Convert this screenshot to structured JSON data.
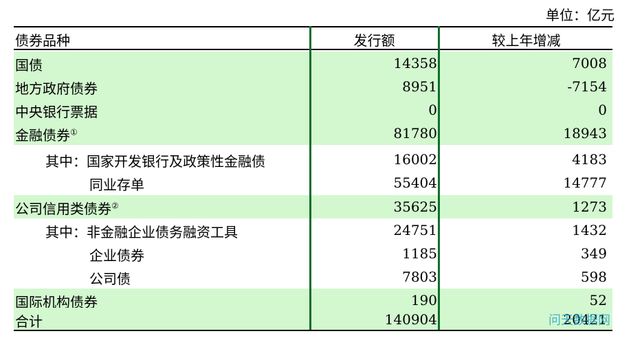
{
  "unit_label": "单位：亿元",
  "headers": {
    "name": "债券品种",
    "col1": "发行额",
    "col2": "较上年增减"
  },
  "rows": [
    {
      "name": "国债",
      "value": "14358",
      "change": "7008",
      "note": ""
    },
    {
      "name": "地方政府债券",
      "value": "8951",
      "change": "-7154",
      "note": ""
    },
    {
      "name": "中央银行票据",
      "value": "0",
      "change": "0",
      "note": ""
    },
    {
      "name": "金融债券",
      "value": "81780",
      "change": "18943",
      "note": "①"
    },
    {
      "name": "其中：国家开发银行及政策性金融债",
      "value": "16002",
      "change": "4183",
      "note": ""
    },
    {
      "name": "同业存单",
      "value": "55404",
      "change": "14777",
      "note": ""
    },
    {
      "name": "公司信用类债券",
      "value": "35625",
      "change": "1273",
      "note": "②"
    },
    {
      "name": "其中：非金融企业债务融资工具",
      "value": "24751",
      "change": "1432",
      "note": ""
    },
    {
      "name": "企业债券",
      "value": "1185",
      "change": "349",
      "note": ""
    },
    {
      "name": "公司债",
      "value": "7803",
      "change": "598",
      "note": ""
    },
    {
      "name": "国际机构债券",
      "value": "190",
      "change": "52",
      "note": ""
    },
    {
      "name": "合计",
      "value": "140904",
      "change": "20421",
      "note": ""
    }
  ],
  "watermark": "问天数据网",
  "colors": {
    "highlight": "#d3f8cf",
    "divider": "#0f6e2c"
  }
}
